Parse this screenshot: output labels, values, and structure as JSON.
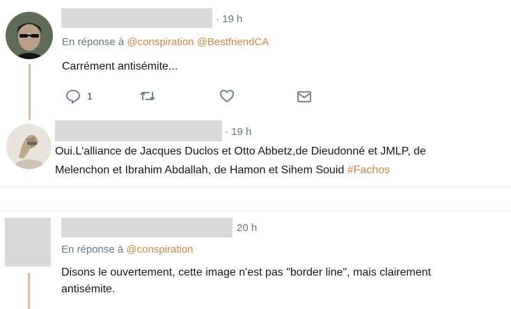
{
  "tweets": [
    {
      "time": "· 19 h",
      "reply_prefix": "En réponse à",
      "reply_mentions": [
        "@conspiration",
        "@BestfriendCA"
      ],
      "text": "Carrément antisémite...",
      "actions": {
        "reply_count": "1"
      }
    },
    {
      "time": "· 19 h",
      "text_line1": "Oui.L'alliance de Jacques Duclos et Otto Abbetz,de Dieudonné et JMLP, de",
      "text_line2_plain": "Melenchon et Ibrahim Abdallah, de Hamon et Sihem Souid ",
      "hashtag": "#Fachos"
    },
    {
      "time": "20 h",
      "reply_prefix": "En réponse à",
      "reply_mentions": [
        "@conspiration"
      ],
      "text_line1": "Disons le ouvertement, cette image n'est pas \"border line\", mais clairement",
      "text_line2": "antisémite."
    }
  ],
  "colors": {
    "accent": "#d4873f",
    "muted": "#657786",
    "thread": "#d9b8a8",
    "redaction": "#d9d9d9"
  },
  "icons": [
    "reply-icon",
    "retweet-icon",
    "like-icon",
    "message-icon"
  ]
}
